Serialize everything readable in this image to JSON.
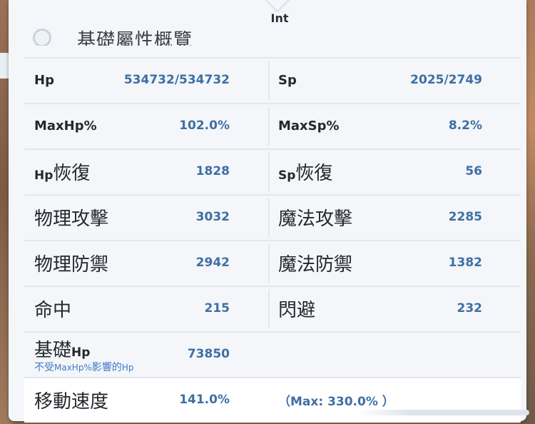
{
  "header": {
    "tab_label": "Int",
    "section_title_partial": "基礎屬性概覽"
  },
  "stats": {
    "hp": {
      "label": "Hp",
      "value": "534732/534732"
    },
    "sp": {
      "label": "Sp",
      "value": "2025/2749"
    },
    "maxhp_pct": {
      "label": "MaxHp%",
      "value": "102.0%"
    },
    "maxsp_pct": {
      "label": "MaxSp%",
      "value": "8.2%"
    },
    "hp_regen": {
      "label_en": "Hp",
      "label_cn": "恢復",
      "value": "1828"
    },
    "sp_regen": {
      "label_en": "Sp",
      "label_cn": "恢復",
      "value": "56"
    },
    "phys_atk": {
      "label": "物理攻擊",
      "value": "3032"
    },
    "magic_atk": {
      "label": "魔法攻擊",
      "value": "2285"
    },
    "phys_def": {
      "label": "物理防禦",
      "value": "2942"
    },
    "magic_def": {
      "label": "魔法防禦",
      "value": "1382"
    },
    "hit": {
      "label": "命中",
      "value": "215"
    },
    "dodge": {
      "label": "閃避",
      "value": "232"
    },
    "base_hp": {
      "label_cn": "基礎",
      "label_en": "Hp",
      "value": "73850",
      "sub_cn_1": "不受",
      "sub_en_1": "MaxHp%",
      "sub_cn_2": "影響的",
      "sub_en_2": "Hp"
    },
    "move_speed": {
      "label": "移動速度",
      "value": "141.0%",
      "max_note": "（Max: 330.0% ）"
    }
  },
  "colors": {
    "value_blue": "#3d6fa5",
    "sublabel_blue": "#3f78c7",
    "label_dark": "#23282e",
    "panel_bg": "#f4f6f9",
    "divider": "#e3e7ec"
  }
}
